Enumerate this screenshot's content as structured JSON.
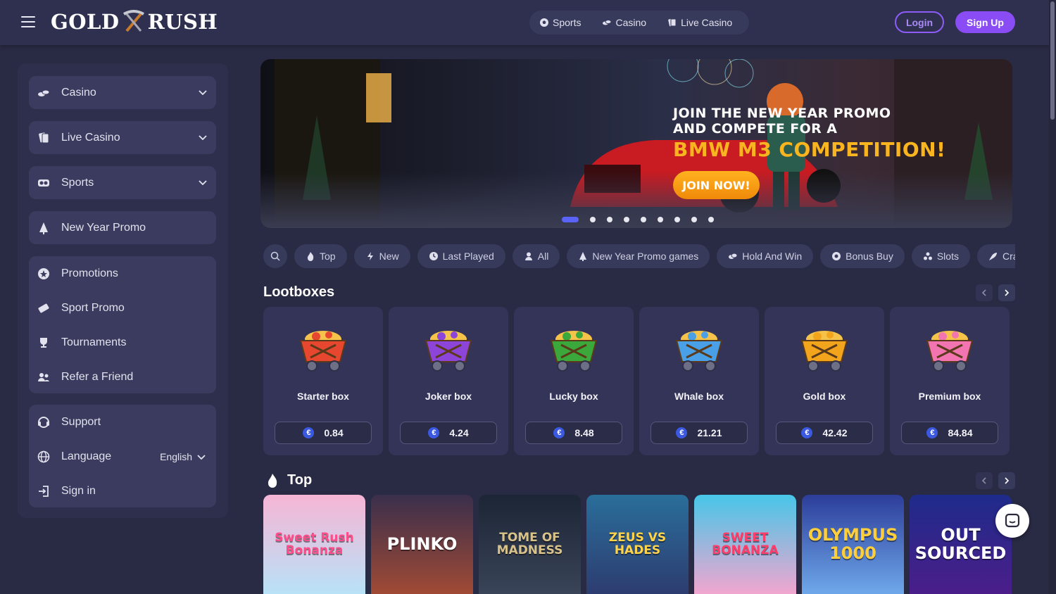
{
  "header": {
    "logo_left": "GOLD",
    "logo_right": "RUSH",
    "nav": [
      {
        "label": "Sports",
        "icon": "soccer-ball-icon"
      },
      {
        "label": "Casino",
        "icon": "casino-chips-icon"
      },
      {
        "label": "Live Casino",
        "icon": "cards-icon"
      }
    ],
    "login_label": "Login",
    "signup_label": "Sign Up"
  },
  "sidebar": {
    "top_items": [
      {
        "label": "Casino",
        "icon": "casino-chips-icon"
      },
      {
        "label": "Live Casino",
        "icon": "cards-icon"
      },
      {
        "label": "Sports",
        "icon": "sports-icon"
      },
      {
        "label": "New Year Promo",
        "icon": "tree-icon"
      }
    ],
    "promo_items": [
      {
        "label": "Promotions",
        "icon": "star-icon"
      },
      {
        "label": "Sport Promo",
        "icon": "ticket-icon"
      },
      {
        "label": "Tournaments",
        "icon": "trophy-icon"
      },
      {
        "label": "Refer a Friend",
        "icon": "users-icon"
      }
    ],
    "support_items": {
      "support": "Support",
      "language": "Language",
      "language_value": "English",
      "signin": "Sign in"
    }
  },
  "banner": {
    "line1": "JOIN THE NEW YEAR PROMO",
    "line2": "AND COMPETE FOR A",
    "highlight": "BMW M3 COMPETITION!",
    "cta": "JOIN NOW!",
    "slides_total": 9,
    "active_slide": 1
  },
  "filters": [
    {
      "label": "Top",
      "icon": "fire-icon"
    },
    {
      "label": "New",
      "icon": "bolt-icon"
    },
    {
      "label": "Last Played",
      "icon": "clock-icon"
    },
    {
      "label": "All",
      "icon": "user-icon"
    },
    {
      "label": "New Year Promo games",
      "icon": "tree-icon"
    },
    {
      "label": "Hold And Win",
      "icon": "coins-icon"
    },
    {
      "label": "Bonus Buy",
      "icon": "gear-icon"
    },
    {
      "label": "Slots",
      "icon": "slots-icon"
    },
    {
      "label": "Cras",
      "icon": "rocket-icon"
    }
  ],
  "lootboxes": {
    "title": "Lootboxes",
    "currency_symbol": "€",
    "items": [
      {
        "name": "Starter box",
        "price": "0.84",
        "accent": "#e8472f"
      },
      {
        "name": "Joker box",
        "price": "4.24",
        "accent": "#8c45d8"
      },
      {
        "name": "Lucky box",
        "price": "8.48",
        "accent": "#3aa83a"
      },
      {
        "name": "Whale box",
        "price": "21.21",
        "accent": "#4aa0e6"
      },
      {
        "name": "Gold box",
        "price": "42.42",
        "accent": "#f2a51c"
      },
      {
        "name": "Premium box",
        "price": "84.84",
        "accent": "#f274b0"
      }
    ]
  },
  "top_section": {
    "title": "Top",
    "games": [
      {
        "title": "Sweet Rush Bonanza",
        "bg1": "#f6b5d5",
        "bg2": "#b8e2f7",
        "color": "#ff4d8a"
      },
      {
        "title": "PLINKO",
        "bg1": "#3a2f4c",
        "bg2": "#a04a35",
        "color": "#ffffff"
      },
      {
        "title": "TOME OF MADNESS",
        "bg1": "#1c2535",
        "bg2": "#3a4458",
        "color": "#d8c28a"
      },
      {
        "title": "ZEUS VS HADES",
        "bg1": "#2a6e9a",
        "bg2": "#2d3c70",
        "color": "#ffd34a"
      },
      {
        "title": "SWEET BONANZA",
        "bg1": "#47c6e8",
        "bg2": "#f1a6cf",
        "color": "#ff3d6a"
      },
      {
        "title": "OLYMPUS 1000",
        "bg1": "#2c3d9a",
        "bg2": "#6fa8ea",
        "color": "#ffcf3a"
      },
      {
        "title": "OUT SOURCED",
        "bg1": "#1e2b8a",
        "bg2": "#4b1e8a",
        "color": "#ffffff"
      }
    ]
  },
  "colors": {
    "accent": "#8a4cf5",
    "gold": "#f9b51f",
    "background": "#292a44"
  }
}
